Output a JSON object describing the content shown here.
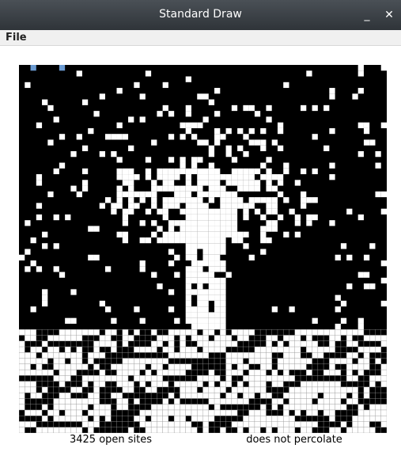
{
  "window": {
    "title": "Standard Draw",
    "minimize_glyph": "_",
    "close_glyph": "✕"
  },
  "menu": {
    "file_label": "File"
  },
  "grid": {
    "size": 64,
    "colors": {
      "blocked": "#000000",
      "open": "#ffffff",
      "full": "#6b9bd2",
      "grid_line": "#9a9a9a"
    }
  },
  "status": {
    "open_sites": "3425 open sites",
    "percolation": "does not percolate"
  }
}
